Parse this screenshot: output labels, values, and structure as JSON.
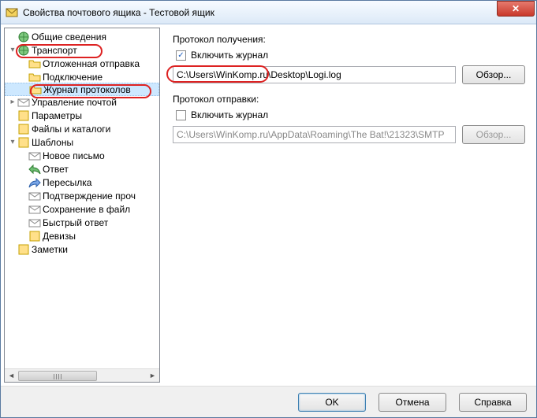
{
  "window": {
    "title": "Свойства почтового ящика - Тестовой ящик"
  },
  "tree": {
    "items": [
      {
        "label": "Общие сведения",
        "depth": 0,
        "icon": "globe-icon"
      },
      {
        "label": "Транспорт",
        "depth": 0,
        "icon": "globe-arrow-icon",
        "expander": "▾",
        "highlight": true
      },
      {
        "label": "Отложенная отправка",
        "depth": 1,
        "icon": "folder-clock-icon"
      },
      {
        "label": "Подключение",
        "depth": 1,
        "icon": "folder-plug-icon"
      },
      {
        "label": "Журнал протоколов",
        "depth": 1,
        "icon": "folder-log-icon",
        "highlight": true,
        "selected": true
      },
      {
        "label": "Управление почтой",
        "depth": 0,
        "icon": "mail-gear-icon",
        "expander": "▸"
      },
      {
        "label": "Параметры",
        "depth": 0,
        "icon": "options-icon"
      },
      {
        "label": "Файлы и каталоги",
        "depth": 0,
        "icon": "files-icon"
      },
      {
        "label": "Шаблоны",
        "depth": 0,
        "icon": "templates-icon",
        "expander": "▾"
      },
      {
        "label": "Новое письмо",
        "depth": 1,
        "icon": "mail-new-icon"
      },
      {
        "label": "Ответ",
        "depth": 1,
        "icon": "mail-reply-icon"
      },
      {
        "label": "Пересылка",
        "depth": 1,
        "icon": "mail-forward-icon"
      },
      {
        "label": "Подтверждение проч",
        "depth": 1,
        "icon": "mail-confirm-icon"
      },
      {
        "label": "Сохранение в файл",
        "depth": 1,
        "icon": "mail-save-icon"
      },
      {
        "label": "Быстрый ответ",
        "depth": 1,
        "icon": "mail-quick-icon"
      },
      {
        "label": "Девизы",
        "depth": 1,
        "icon": "motto-icon"
      },
      {
        "label": "Заметки",
        "depth": 0,
        "icon": "notes-icon"
      }
    ]
  },
  "right": {
    "receive_label": "Протокол получения:",
    "receive_check": "Включить журнал",
    "receive_path": "C:\\Users\\WinKomp.ru\\Desktop\\Logi.log",
    "browse": "Обзор...",
    "send_label": "Протокол отправки:",
    "send_check": "Включить журнал",
    "send_path": "C:\\Users\\WinKomp.ru\\AppData\\Roaming\\The Bat!\\21323\\SMTP"
  },
  "buttons": {
    "ok": "OK",
    "cancel": "Отмена",
    "help": "Справка"
  }
}
